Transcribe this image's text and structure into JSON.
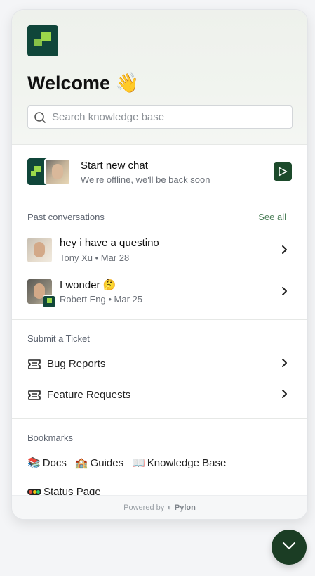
{
  "header": {
    "title": "Welcome",
    "wave_emoji": "👋",
    "search_placeholder": "Search knowledge base"
  },
  "new_chat": {
    "title": "Start new chat",
    "subtitle": "We're offline, we'll be back soon"
  },
  "past_conversations": {
    "title": "Past conversations",
    "see_all": "See all",
    "items": [
      {
        "title": "hey i have a questino",
        "author": "Tony Xu",
        "date": "Mar 28"
      },
      {
        "title": "I wonder 🤔",
        "author": "Robert Eng",
        "date": "Mar 25"
      }
    ]
  },
  "tickets": {
    "title": "Submit a Ticket",
    "items": [
      {
        "label": "Bug Reports"
      },
      {
        "label": "Feature Requests"
      }
    ]
  },
  "bookmarks": {
    "title": "Bookmarks",
    "items": [
      {
        "emoji": "📚",
        "label": "Docs"
      },
      {
        "emoji": "🏫",
        "label": "Guides"
      },
      {
        "emoji": "📖",
        "label": "Knowledge Base"
      },
      {
        "emoji": "",
        "label": "Status Page"
      }
    ]
  },
  "footer": {
    "powered_by": "Powered by",
    "brand": "Pylon"
  },
  "colors": {
    "brand_dark": "#10463a",
    "brand_lime": "#9bd84a",
    "fab": "#1b3d24",
    "link": "#4a7d57"
  }
}
